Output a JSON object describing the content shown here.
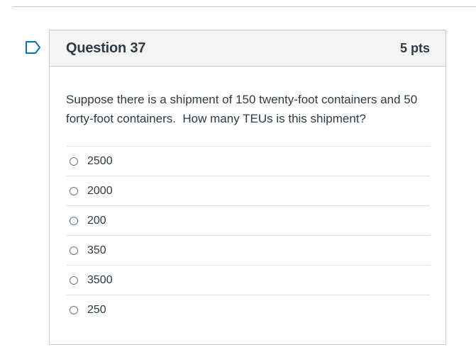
{
  "question": {
    "title": "Question 37",
    "points": "5 pts",
    "text": "Suppose there is a shipment of 150 twenty-foot containers and 50 forty-foot containers.  How many TEUs is this shipment?",
    "answers": [
      {
        "label": "2500"
      },
      {
        "label": "2000"
      },
      {
        "label": "200"
      },
      {
        "label": "350"
      },
      {
        "label": "3500"
      },
      {
        "label": "250"
      }
    ]
  },
  "icons": {
    "flag": "bookmark-flag-icon"
  },
  "colors": {
    "accent": "#0374b5",
    "text": "#2d3b45",
    "border": "#c7cdd1",
    "header_bg": "#f5f5f5"
  }
}
